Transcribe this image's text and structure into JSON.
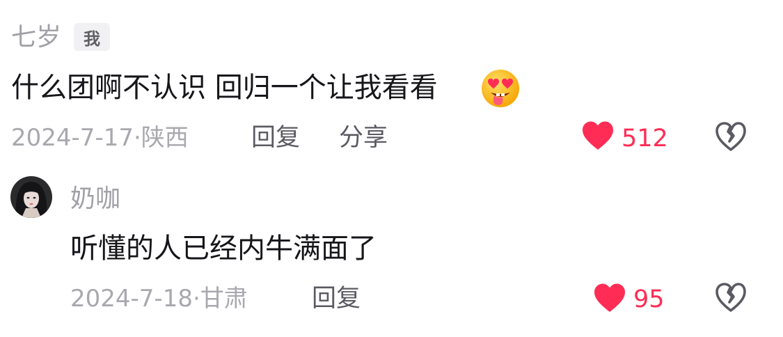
{
  "colors": {
    "like": "#ff2d55",
    "muted": "#a8a8ae",
    "text": "#16161a",
    "action": "#5a5a62"
  },
  "comments": [
    {
      "username": "七岁",
      "badge": "我",
      "text": "什么团啊不认识 回归一个让我看看",
      "emoji": "star-struck-tongue-emoji",
      "date": "2024-7-17",
      "location": "陕西",
      "reply_label": "回复",
      "share_label": "分享",
      "likes": "512",
      "like_icon": "heart-icon",
      "dislike_icon": "broken-heart-icon"
    },
    {
      "username": "奶咖",
      "text": "听懂的人已经内牛满面了",
      "date": "2024-7-18",
      "location": "甘肃",
      "reply_label": "回复",
      "likes": "95",
      "like_icon": "heart-icon",
      "dislike_icon": "broken-heart-icon"
    }
  ]
}
